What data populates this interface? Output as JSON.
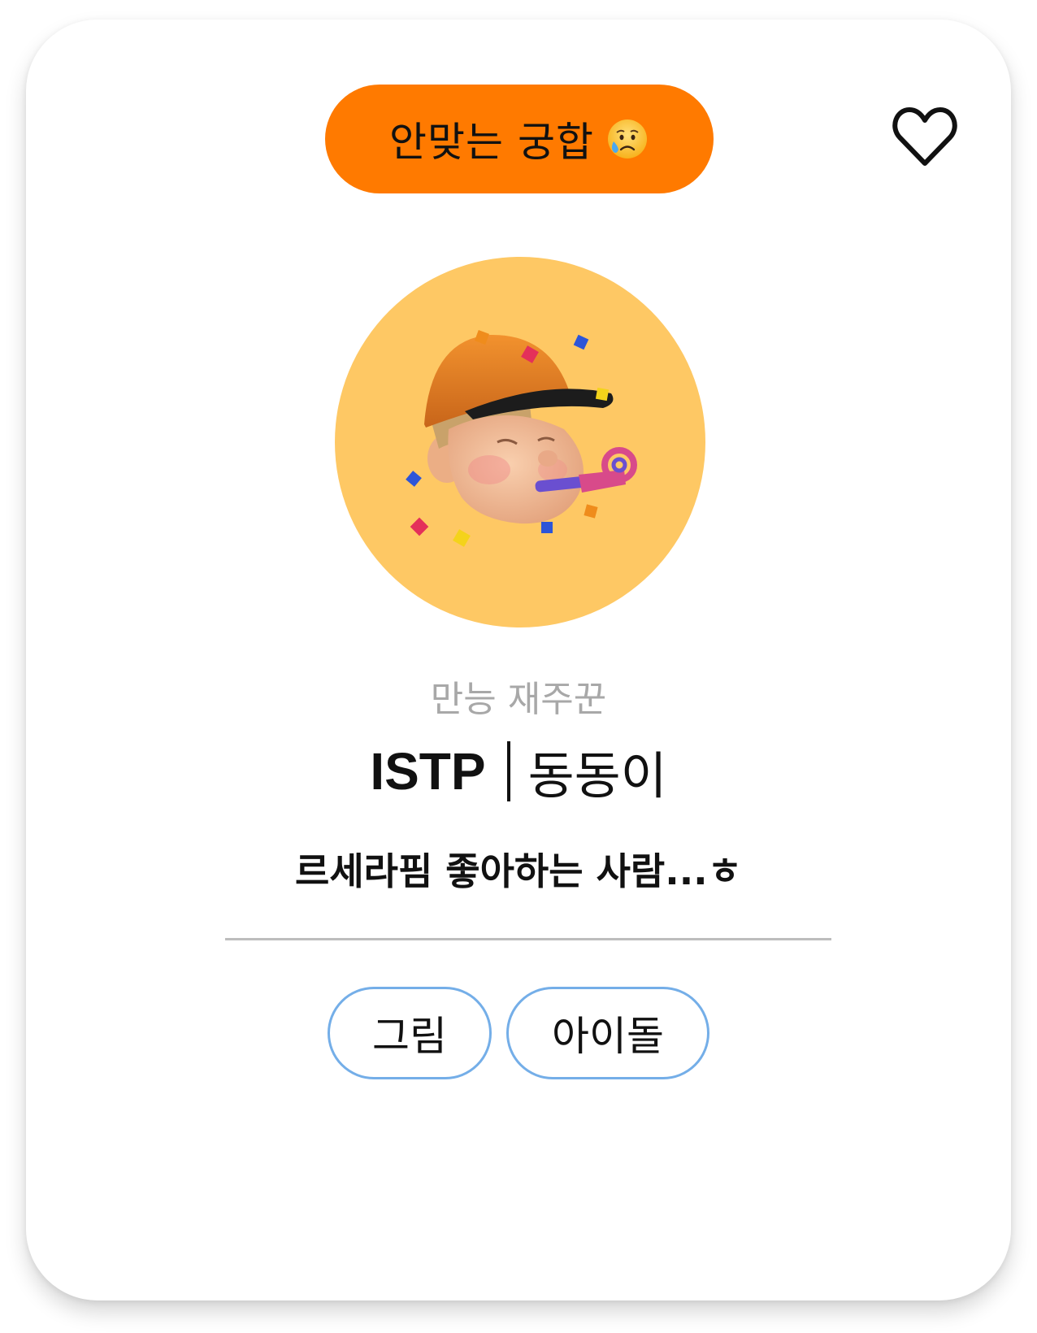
{
  "card": {
    "match_badge": {
      "label": "안맞는 궁합",
      "emoji_icon": "sad-sweat-face-icon",
      "color": "#ff7a00"
    },
    "favorite_icon": "heart-outline-icon",
    "avatar": {
      "icon": "party-memoji-avatar",
      "background": "#fec864"
    },
    "subtitle": "만능 재주꾼",
    "mbti": "ISTP",
    "nickname": "동동이",
    "bio": "르세라핌 좋아하는 사람...ㅎ",
    "tags": [
      "그림",
      "아이돌"
    ],
    "tag_border_color": "#74aee8"
  }
}
